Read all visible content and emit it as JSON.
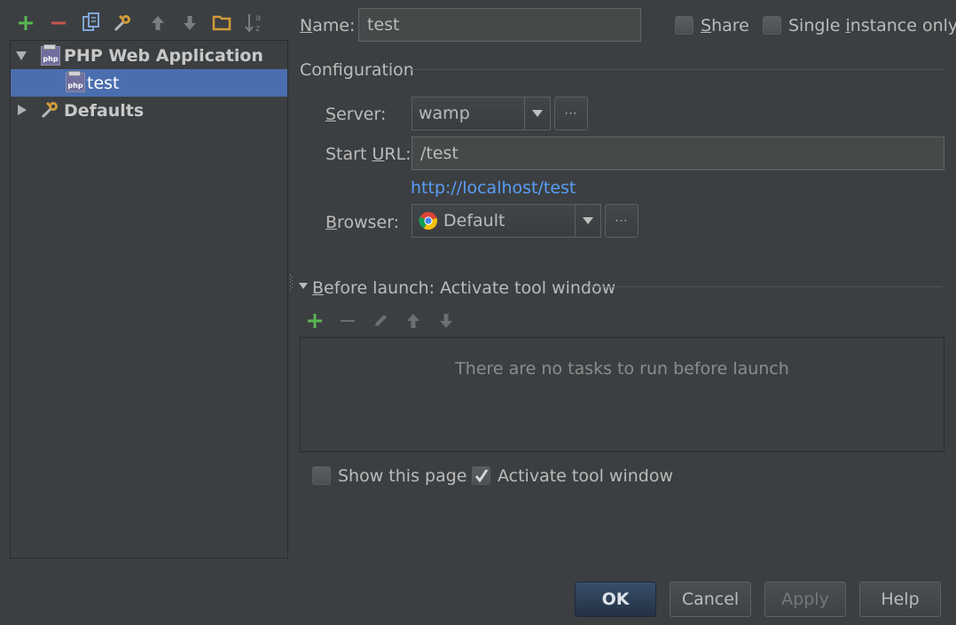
{
  "toolbar": {
    "add": "add-icon",
    "remove": "remove-icon",
    "copy": "copy-icon",
    "edit_defaults": "wrench-icon",
    "move_up": "arrow-up-icon",
    "move_down": "arrow-down-icon",
    "folder": "folder-icon",
    "sort": "sort-az-icon"
  },
  "tree": {
    "items": [
      {
        "label": "PHP Web Application",
        "expanded": true,
        "bold": true
      },
      {
        "label": "test",
        "selected": true
      },
      {
        "label": "Defaults",
        "expanded": false,
        "bold": true
      }
    ]
  },
  "form": {
    "name_label_prefix": "N",
    "name_label_rest": "ame:",
    "name_value": "test",
    "share_label_prefix": "S",
    "share_label_rest": "hare",
    "single_instance_label_a": "Single ",
    "single_instance_label_u": "i",
    "single_instance_label_b": "nstance only",
    "configuration_label": "Configuration",
    "server_label_u": "S",
    "server_label_rest": "erver:",
    "server_value": "wamp",
    "start_url_label_a": "Start ",
    "start_url_label_u": "U",
    "start_url_label_b": "RL:",
    "start_url_value": "/test",
    "resolved_url": "http://localhost/test",
    "browser_label_u": "B",
    "browser_label_rest": "rowser:",
    "browser_value": "Default",
    "ellipsis": "···"
  },
  "before_launch": {
    "title_u": "B",
    "title_rest": "efore launch: Activate tool window",
    "empty_text": "There are no tasks to run before launch",
    "show_page_label": "Show this page",
    "show_page_checked": false,
    "activate_tool_window_label": "Activate tool window",
    "activate_tool_window_checked": true
  },
  "buttons": {
    "ok": "OK",
    "cancel": "Cancel",
    "apply": "Apply",
    "help": "Help"
  },
  "colors": {
    "background": "#3c3f41",
    "selection": "#4b6eaf",
    "link": "#589df6",
    "add_green": "#5ab552",
    "remove_red": "#c75450",
    "default_button": "#2e4159"
  }
}
